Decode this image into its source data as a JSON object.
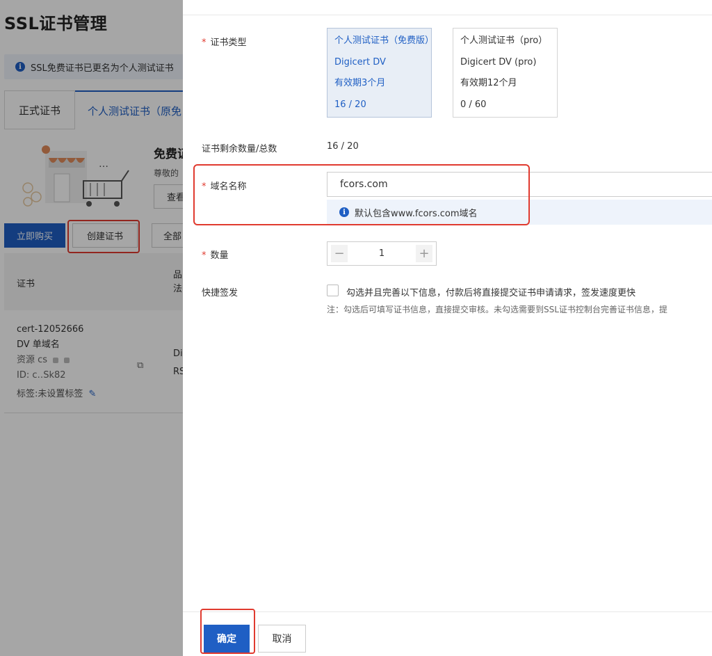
{
  "background": {
    "page_title": "SSL证书管理",
    "notice": "SSL免费证书已更名为个人测试证书",
    "tabs": [
      "正式证书",
      "个人测试证书（原免"
    ],
    "promo_title": "免费证",
    "promo_sub": "尊敬的",
    "promo_button": "查看",
    "buy_button": "立即购买",
    "create_button": "创建证书",
    "all_button": "全部",
    "table_header_cert": "证书",
    "table_header_prod_1": "品",
    "table_header_prod_2": "法",
    "row": {
      "cert_id": "cert-12052666",
      "type": "DV 单域名",
      "resource_label": "资源",
      "resource_value": "cs",
      "id_label": "ID:",
      "id_value": "c‥Sk82",
      "tag_text": "标签:未设置标签",
      "col2_1": "Di",
      "col2_2": "RS"
    }
  },
  "form": {
    "cert_type_label": "证书类型",
    "cert_types": [
      {
        "name": "个人测试证书（免费版）",
        "brand": "Digicert DV",
        "validity": "有效期3个月",
        "quota": "16 / 20"
      },
      {
        "name": "个人测试证书（pro）",
        "brand": "Digicert DV (pro)",
        "validity": "有效期12个月",
        "quota": "0 / 60"
      }
    ],
    "remaining_label": "证书剩余数量/总数",
    "remaining_value": "16 / 20",
    "domain_label": "域名名称",
    "domain_value": "fcors.com",
    "domain_hint": "默认包含www.fcors.com域名",
    "quantity_label": "数量",
    "quantity_value": "1",
    "quick_label": "快捷签发",
    "quick_checkbox_text": "勾选并且完善以下信息，付款后将直接提交证书申请请求，签发速度更快",
    "quick_note": "注：勾选后可填写证书信息，直接提交审核。未勾选需要到SSL证书控制台完善证书信息，提"
  },
  "footer": {
    "confirm": "确定",
    "cancel": "取消"
  },
  "colors": {
    "primary": "#1f5fc4",
    "highlight": "#e03a2f",
    "required": "#e03a2f"
  }
}
